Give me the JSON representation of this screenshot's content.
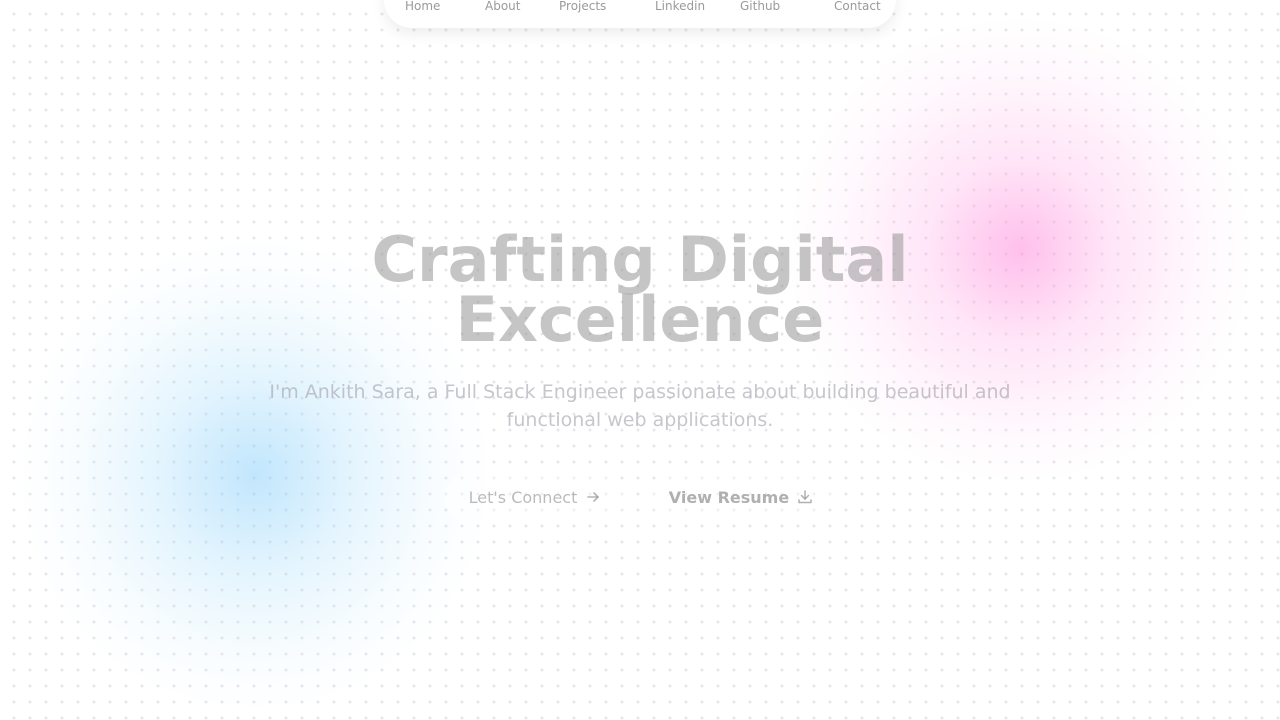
{
  "nav": {
    "items": [
      {
        "label": "Home"
      },
      {
        "label": "About"
      },
      {
        "label": "Projects"
      },
      {
        "label": "Linkedin"
      },
      {
        "label": "Github"
      },
      {
        "label": "Contact"
      }
    ]
  },
  "hero": {
    "title_line1": "Crafting Digital",
    "title_line2": "Excellence",
    "subtitle": "I'm Ankith Sara, a Full Stack Engineer passionate about building beautiful and functional web applications.",
    "connect_label": "Let's Connect",
    "connect_icon": "arrow-right-icon",
    "resume_label": "View Resume",
    "resume_icon": "download-icon"
  },
  "colors": {
    "background": "#ffffff",
    "blob_pink": "#ff8cdc",
    "blob_blue": "#78c8fa",
    "muted_text": "#9a9a9a"
  }
}
